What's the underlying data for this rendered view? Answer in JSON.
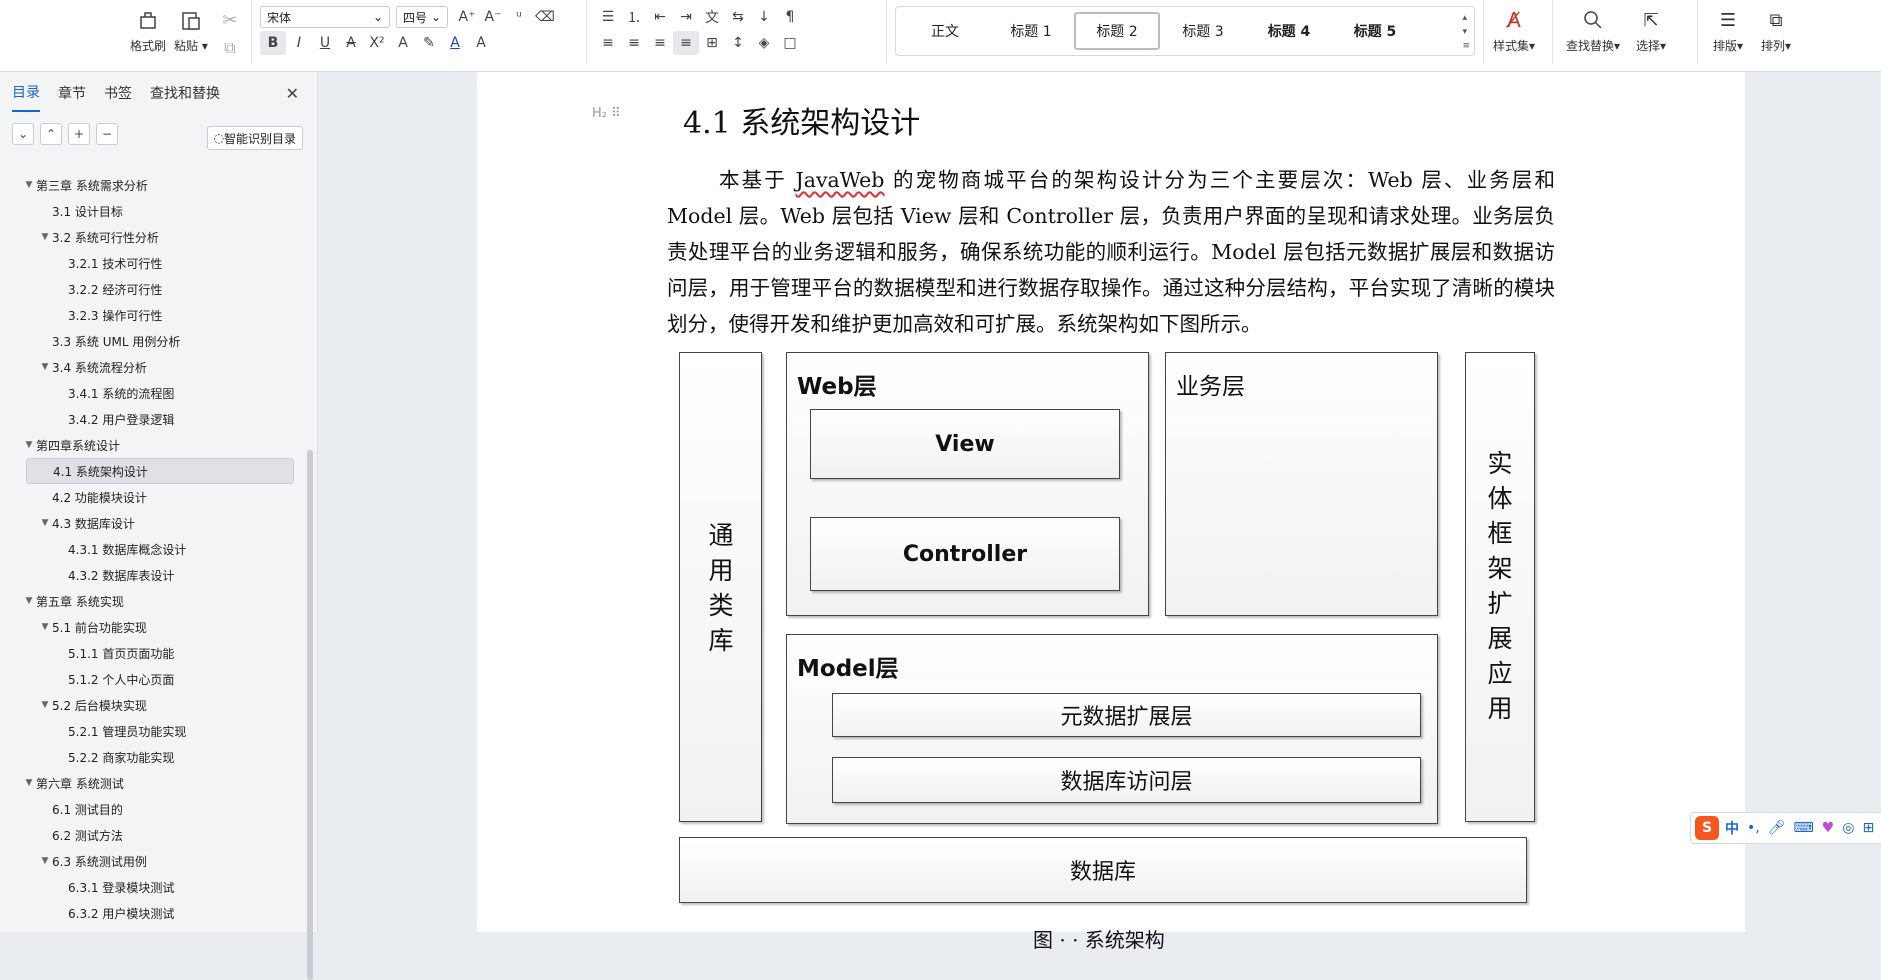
{
  "ribbon": {
    "format_painter": "格式刷",
    "paste": "粘贴",
    "font_name": "宋体",
    "font_size": "四号",
    "styles": [
      "正文",
      "标题 1",
      "标题 2",
      "标题 3",
      "标题 4",
      "标题 5"
    ],
    "active_style": "标题 2",
    "style_set": "样式集",
    "find_replace": "查找替换",
    "select": "选择",
    "layout": "排版",
    "arrange": "排列"
  },
  "nav": {
    "tabs": [
      "目录",
      "章节",
      "书签",
      "查找和替换"
    ],
    "smart_toc": "智能识别目录",
    "toc": [
      {
        "label": "第三章  系统需求分析",
        "level": 1,
        "arrow": true
      },
      {
        "label": "3.1 设计目标",
        "level": 2,
        "arrow": false
      },
      {
        "label": "3.2 系统可行性分析",
        "level": 2,
        "arrow": true
      },
      {
        "label": "3.2.1 技术可行性",
        "level": 3,
        "arrow": false
      },
      {
        "label": "3.2.2 经济可行性",
        "level": 3,
        "arrow": false
      },
      {
        "label": "3.2.3 操作可行性",
        "level": 3,
        "arrow": false
      },
      {
        "label": "3.3 系统 UML 用例分析",
        "level": 2,
        "arrow": false
      },
      {
        "label": "3.4 系统流程分析",
        "level": 2,
        "arrow": true
      },
      {
        "label": "3.4.1 系统的流程图",
        "level": 3,
        "arrow": false
      },
      {
        "label": "3.4.2 用户登录逻辑",
        "level": 3,
        "arrow": false
      },
      {
        "label": "第四章系统设计",
        "level": 1,
        "arrow": true
      },
      {
        "label": "4.1  系统架构设计",
        "level": 2,
        "arrow": false,
        "selected": true
      },
      {
        "label": "4.2 功能模块设计",
        "level": 2,
        "arrow": false
      },
      {
        "label": "4.3  数据库设计",
        "level": 2,
        "arrow": true
      },
      {
        "label": "4.3.1 数据库概念设计",
        "level": 3,
        "arrow": false
      },
      {
        "label": "4.3.2  数据库表设计",
        "level": 3,
        "arrow": false
      },
      {
        "label": "第五章  系统实现",
        "level": 1,
        "arrow": true
      },
      {
        "label": "5.1 前台功能实现",
        "level": 2,
        "arrow": true
      },
      {
        "label": "5.1.1 首页页面功能",
        "level": 3,
        "arrow": false
      },
      {
        "label": "5.1.2 个人中心页面",
        "level": 3,
        "arrow": false
      },
      {
        "label": "5.2 后台模块实现",
        "level": 2,
        "arrow": true
      },
      {
        "label": "5.2.1 管理员功能实现",
        "level": 3,
        "arrow": false
      },
      {
        "label": "5.2.2 商家功能实现",
        "level": 3,
        "arrow": false
      },
      {
        "label": "第六章  系统测试",
        "level": 1,
        "arrow": true
      },
      {
        "label": "6.1 测试目的",
        "level": 2,
        "arrow": false
      },
      {
        "label": "6.2 测试方法",
        "level": 2,
        "arrow": false
      },
      {
        "label": "6.3 系统测试用例",
        "level": 2,
        "arrow": true
      },
      {
        "label": "6.3.1 登录模块测试",
        "level": 3,
        "arrow": false
      },
      {
        "label": "6.3.2 用户模块测试",
        "level": 3,
        "arrow": false
      }
    ]
  },
  "doc": {
    "heading_mark": "H₂",
    "heading": "4.1  系统架构设计",
    "para_pre": "本基于 ",
    "para_err": "JavaWeb",
    "para_post": " 的宠物商城平台的架构设计分为三个主要层次：Web 层、业务层和 Model 层。Web 层包括 View 层和 Controller 层，负责用户界面的呈现和请求处理。业务层负责处理平台的业务逻辑和服务，确保系统功能的顺利运行。Model 层包括元数据扩展层和数据访问层，用于管理平台的数据模型和进行数据存取操作。通过这种分层结构，平台实现了清晰的模块划分，使得开发和维护更加高效和可扩展。系统架构如下图所示。",
    "diagram": {
      "common_lib": "通用类库",
      "web_layer": "Web层",
      "view": "View",
      "controller": "Controller",
      "business_layer": "业务层",
      "entity_ext": "实体框架扩展应用",
      "model_layer": "Model层",
      "meta_ext": "元数据扩展层",
      "db_access": "数据库访问层",
      "database": "数据库"
    },
    "caption": "图 · · 系统架构"
  },
  "ime": {
    "lang": "中"
  }
}
